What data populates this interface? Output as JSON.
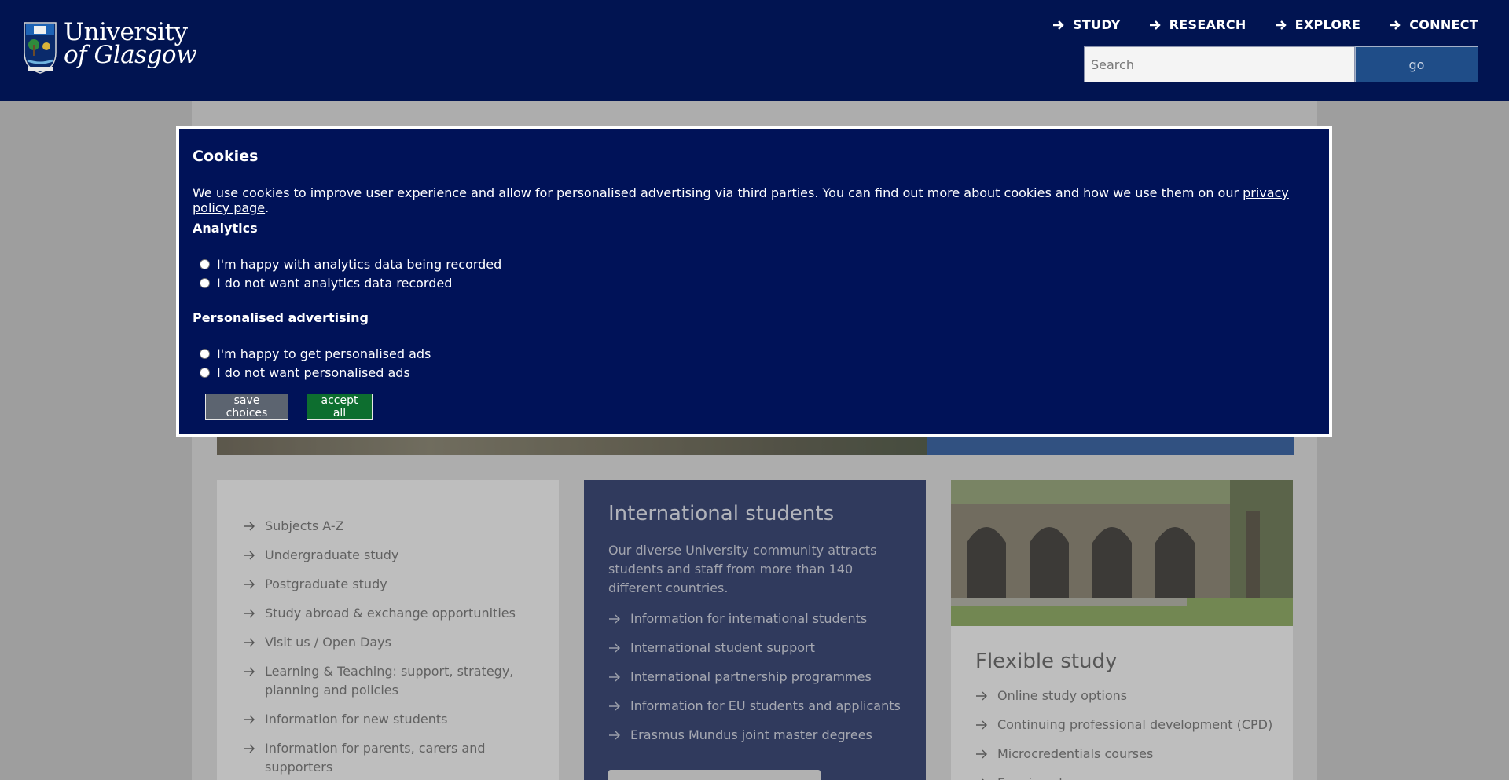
{
  "header": {
    "logo_line1": "University",
    "logo_line2": "of Glasgow",
    "nav": [
      {
        "label": "STUDY"
      },
      {
        "label": "RESEARCH"
      },
      {
        "label": "EXPLORE"
      },
      {
        "label": "CONNECT"
      }
    ],
    "search": {
      "placeholder": "Search",
      "button": "go"
    }
  },
  "study_links": [
    "Subjects A-Z",
    "Undergraduate study",
    "Postgraduate study",
    "Study abroad & exchange opportunities",
    "Visit us / Open Days",
    "Learning & Teaching: support, strategy, planning and policies",
    "Information for new students",
    "Information for parents, carers and supporters"
  ],
  "international": {
    "title": "International students",
    "description": "Our diverse University community attracts students and staff from more than 140 different countries.",
    "links": [
      "Information for international students",
      "International student support",
      "International partnership programmes",
      "Information for EU students and applicants",
      "Erasmus Mundus joint master degrees"
    ]
  },
  "flexible": {
    "title": "Flexible study",
    "links": [
      "Online study options",
      "Continuing professional development (CPD)",
      "Microcredentials courses",
      "Evening classes"
    ]
  },
  "cookies": {
    "title": "Cookies",
    "intro": "We use cookies to improve user experience and allow for personalised advertising via third parties. You can find out more about cookies and how we use them on our ",
    "privacy_link": "privacy policy page",
    "intro_end": ".",
    "analytics_heading": "Analytics",
    "analytics_yes": "I'm happy with analytics data being recorded",
    "analytics_no": "I do not want analytics data recorded",
    "ads_heading": "Personalised advertising",
    "ads_yes": "I'm happy to get personalised ads",
    "ads_no": "I do not want personalised ads",
    "save_label": "save choices",
    "accept_label": "accept all"
  }
}
